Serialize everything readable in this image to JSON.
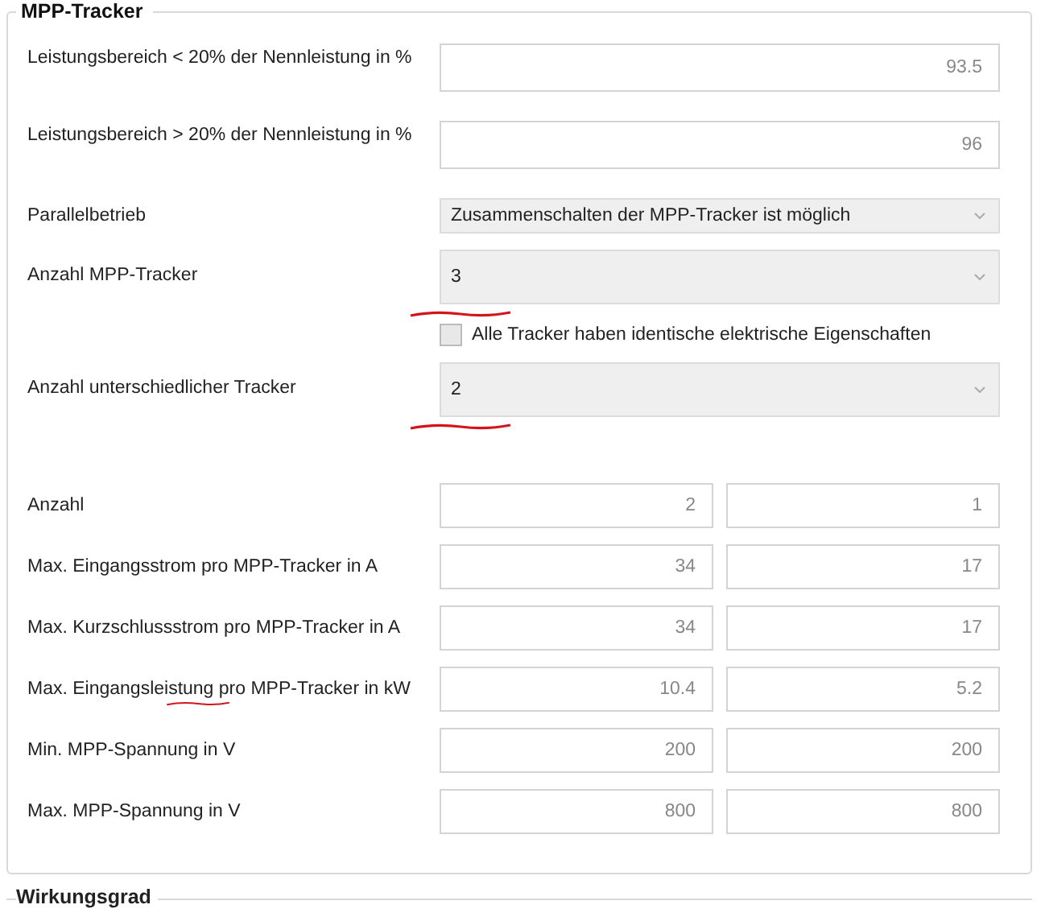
{
  "group": {
    "title": "MPP-Tracker",
    "rows": [
      {
        "kind": "input",
        "label": "Leistungsbereich < 20% der Nennleistung in %",
        "value": "93.5"
      },
      {
        "kind": "input",
        "label": "Leistungsbereich > 20% der Nennleistung in %",
        "value": "96"
      },
      {
        "kind": "select",
        "label": "Parallelbetrieb",
        "value": "Zusammenschalten der MPP-Tracker ist möglich"
      },
      {
        "kind": "combobox",
        "label": "Anzahl MPP-Tracker",
        "value": "3",
        "annotated": true
      },
      {
        "kind": "checkbox",
        "label": "Alle Tracker haben identische elektrische Eigenschaften",
        "checked": false
      },
      {
        "kind": "combobox",
        "label": "Anzahl unterschiedlicher Tracker",
        "value": "2",
        "annotated": true
      }
    ],
    "pair_rows": [
      {
        "label": "Anzahl",
        "values": [
          "2",
          "1"
        ]
      },
      {
        "label": "Max. Eingangsstrom pro MPP-Tracker in A",
        "values": [
          "34",
          "17"
        ]
      },
      {
        "label": "Max. Kurzschlussstrom pro MPP-Tracker in A",
        "values": [
          "34",
          "17"
        ]
      },
      {
        "label": "Max. Eingangsleistung pro MPP-Tracker in kW",
        "values": [
          "10.4",
          "5.2"
        ],
        "annotated": true
      },
      {
        "label": "Min. MPP-Spannung in V",
        "values": [
          "200",
          "200"
        ]
      },
      {
        "label": "Max. MPP-Spannung in V",
        "values": [
          "800",
          "800"
        ]
      }
    ]
  },
  "next_group": {
    "title": "Wirkungsgrad"
  }
}
